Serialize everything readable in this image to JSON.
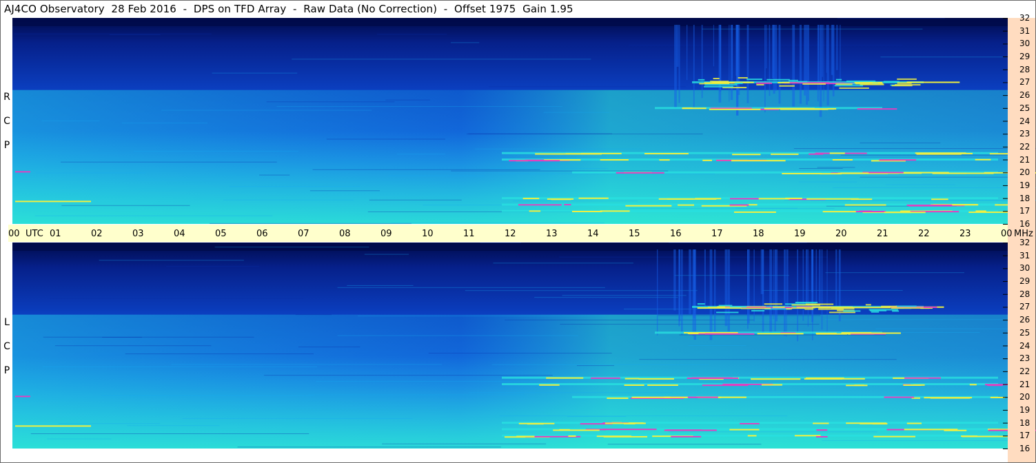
{
  "title": "AJ4CO Observatory  28 Feb 2016  -  DPS on TFD Array  -  Raw Data (No Correction)  -  Offset 1975  Gain 1.95",
  "panels": [
    {
      "id": "rcp",
      "label": [
        "R",
        "C",
        "P"
      ]
    },
    {
      "id": "lcp",
      "label": [
        "L",
        "C",
        "P"
      ]
    }
  ],
  "time_axis": {
    "labels": [
      "00",
      "UTC",
      "01",
      "02",
      "03",
      "04",
      "05",
      "06",
      "07",
      "08",
      "09",
      "10",
      "11",
      "12",
      "13",
      "14",
      "15",
      "16",
      "17",
      "18",
      "19",
      "20",
      "21",
      "22",
      "23",
      "00",
      "MHz"
    ]
  },
  "freq_axis": {
    "labels": [
      "32",
      "31",
      "30",
      "29",
      "28",
      "27",
      "26",
      "25",
      "24",
      "23",
      "22",
      "21",
      "20",
      "19",
      "18",
      "17",
      "16"
    ],
    "unit": "MHz"
  },
  "colors": {
    "deep": "#000a4a",
    "dark": "#0a2fa8",
    "mid": "#1560e8",
    "light": "#18a8f0",
    "cyan": "#28e0e0",
    "yellow": "#f0f040",
    "magenta": "#e040c0",
    "timebar": "#ffffcc",
    "freqbar": "#ffdcc0"
  },
  "chart_data": {
    "type": "heatmap",
    "title": "AJ4CO Observatory  28 Feb 2016  -  DPS on TFD Array  -  Raw Data (No Correction)  -  Offset 1975  Gain 1.95",
    "x": {
      "label": "UTC",
      "range": [
        0,
        24
      ],
      "ticks": [
        0,
        1,
        2,
        3,
        4,
        5,
        6,
        7,
        8,
        9,
        10,
        11,
        12,
        13,
        14,
        15,
        16,
        17,
        18,
        19,
        20,
        21,
        22,
        23,
        24
      ]
    },
    "y": {
      "label": "MHz",
      "range": [
        16,
        32
      ],
      "ticks": [
        16,
        17,
        18,
        19,
        20,
        21,
        22,
        23,
        24,
        25,
        26,
        27,
        28,
        29,
        30,
        31,
        32
      ]
    },
    "series": [
      {
        "name": "RCP",
        "bright_bands_mhz": [
          17,
          17.5,
          18,
          20,
          21,
          21.5,
          25,
          27
        ]
      },
      {
        "name": "LCP",
        "bright_bands_mhz": [
          17,
          17.5,
          18,
          20,
          21,
          21.5,
          25,
          27
        ]
      }
    ]
  }
}
